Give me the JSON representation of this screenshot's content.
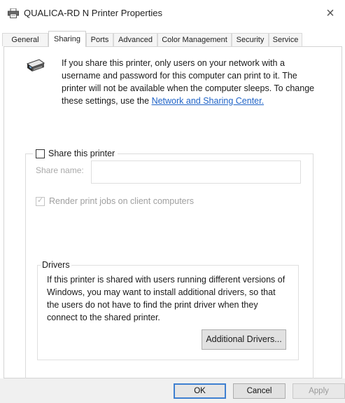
{
  "window": {
    "title": "QUALICA-RD N Printer Properties",
    "icon": "printer-icon",
    "close_glyph": "×"
  },
  "tabs": [
    {
      "label": "General",
      "active": false
    },
    {
      "label": "Sharing",
      "active": true
    },
    {
      "label": "Ports",
      "active": false
    },
    {
      "label": "Advanced",
      "active": false
    },
    {
      "label": "Color Management",
      "active": false
    },
    {
      "label": "Security",
      "active": false
    },
    {
      "label": "Service",
      "active": false
    }
  ],
  "sharing": {
    "info_icon": "shared-printer-icon",
    "info_text": "If you share this printer, only users on your network with a username and password for this computer can print to it. The printer will not be available when the computer sleeps. To change these settings, use the ",
    "info_link": "Network and Sharing Center.",
    "share_printer": {
      "label": "Share this printer",
      "checked": false
    },
    "share_name": {
      "label": "Share name:",
      "value": ""
    },
    "render_jobs": {
      "label": "Render print jobs on client computers",
      "checked": true,
      "disabled": true
    },
    "drivers": {
      "legend": "Drivers",
      "text": "If this printer is shared with users running different versions of Windows, you may want to install additional drivers, so that the users do not have to find the print driver when they connect to the shared printer.",
      "button": "Additional Drivers..."
    }
  },
  "footer": {
    "ok": "OK",
    "cancel": "Cancel",
    "apply": "Apply"
  },
  "colors": {
    "link": "#1f63c7",
    "default_button_border": "#3f80d0"
  }
}
